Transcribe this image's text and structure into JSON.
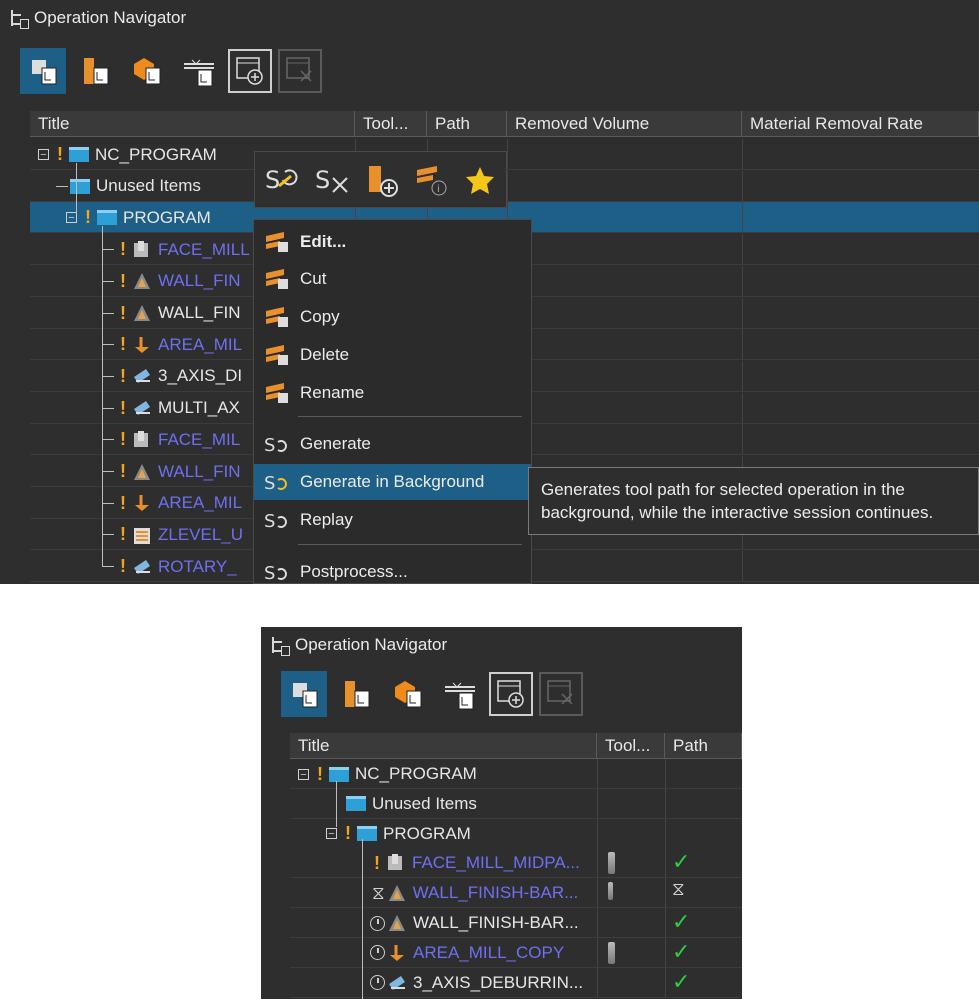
{
  "top": {
    "window_title": "Operation Navigator",
    "columns": [
      "Title",
      "Tool...",
      "Path",
      "Removed Volume",
      "Material Removal Rate"
    ],
    "rows": [
      {
        "label": "NC_PROGRAM",
        "color": "white",
        "kind": "root"
      },
      {
        "label": "Unused Items",
        "color": "white",
        "kind": "folder"
      },
      {
        "label": "PROGRAM",
        "color": "white",
        "kind": "program",
        "selected": true
      },
      {
        "label": "FACE_MILL",
        "color": "blue",
        "icon": "face-mill-icon"
      },
      {
        "label": "WALL_FIN",
        "color": "blue",
        "icon": "wall-finish-icon"
      },
      {
        "label": "WALL_FIN",
        "color": "white",
        "icon": "wall-finish-icon"
      },
      {
        "label": "AREA_MIL",
        "color": "blue",
        "icon": "area-mill-icon"
      },
      {
        "label": "3_AXIS_DI",
        "color": "white",
        "icon": "deburr-icon"
      },
      {
        "label": "MULTI_AX",
        "color": "white",
        "icon": "deburr-icon"
      },
      {
        "label": "FACE_MIL",
        "color": "blue",
        "icon": "face-mill-icon"
      },
      {
        "label": "WALL_FIN",
        "color": "blue",
        "icon": "wall-finish-icon"
      },
      {
        "label": "AREA_MIL",
        "color": "blue",
        "icon": "area-mill-icon"
      },
      {
        "label": "ZLEVEL_U",
        "color": "blue",
        "icon": "zlevel-icon"
      },
      {
        "label": "ROTARY_",
        "color": "blue",
        "icon": "deburr-icon"
      }
    ],
    "context_menu": {
      "items": [
        {
          "label": "Edit...",
          "icon": "edit-icon",
          "bold": true
        },
        {
          "label": "Cut",
          "icon": "cut-icon"
        },
        {
          "label": "Copy",
          "icon": "copy-icon"
        },
        {
          "label": "Delete",
          "icon": "delete-icon"
        },
        {
          "label": "Rename",
          "icon": "rename-icon"
        },
        {
          "label": "Generate",
          "icon": "generate-icon"
        },
        {
          "label": "Generate in Background",
          "icon": "generate-background-icon",
          "highlighted": true
        },
        {
          "label": "Replay",
          "icon": "replay-icon"
        },
        {
          "label": "Postprocess...",
          "icon": "postprocess-icon"
        }
      ]
    },
    "mini_toolbar": [
      "generate-icon",
      "delete-path-icon",
      "create-operation-icon",
      "operation-info-icon",
      "favorite-star-icon"
    ],
    "tooltip": {
      "line1": "Generates tool path for selected operation in the",
      "line2": "background, while the interactive session continues."
    }
  },
  "bottom": {
    "window_title": "Operation Navigator",
    "columns": [
      "Title",
      "Tool...",
      "Path"
    ],
    "rows": [
      {
        "label": "NC_PROGRAM",
        "color": "white",
        "kind": "root"
      },
      {
        "label": "Unused Items",
        "color": "white",
        "kind": "folder"
      },
      {
        "label": "PROGRAM",
        "color": "white",
        "kind": "program"
      },
      {
        "label": "FACE_MILL_MIDPA...",
        "color": "blue",
        "status": "exclaim",
        "tool": "mill",
        "path": "✓"
      },
      {
        "label": "WALL_FINISH-BAR...",
        "color": "blue",
        "status": "hourglass",
        "tool": "drill",
        "path": "⧖"
      },
      {
        "label": "WALL_FINISH-BAR...",
        "color": "white",
        "status": "clock",
        "tool": "",
        "path": "✓"
      },
      {
        "label": "AREA_MILL_COPY",
        "color": "blue",
        "status": "clock",
        "tool": "mill",
        "path": "✓"
      },
      {
        "label": "3_AXIS_DEBURRIN...",
        "color": "white",
        "status": "clock",
        "tool": "",
        "path": "✓"
      }
    ]
  }
}
